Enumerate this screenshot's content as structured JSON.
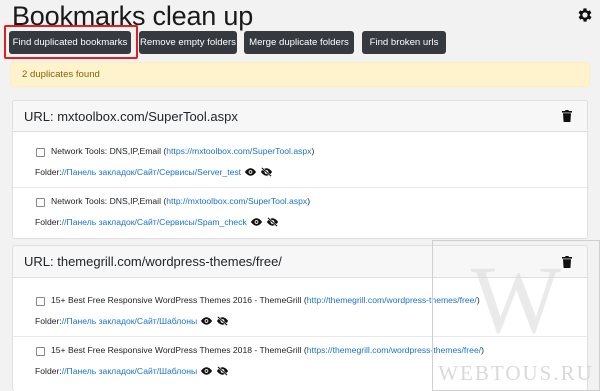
{
  "header": {
    "title": "Bookmarks clean up",
    "settings_icon": "gear-icon"
  },
  "toolbar": {
    "find_duplicates": "Find duplicated bookmarks",
    "remove_empty": "Remove empty folders",
    "merge_duplicates": "Merge duplicate folders",
    "find_broken": "Find broken urls"
  },
  "alert": {
    "text": "2 duplicates found"
  },
  "groups": [
    {
      "url_label": "URL: mxtoolbox.com/SuperTool.aspx",
      "items": [
        {
          "title": "Network Tools: DNS,IP,Email (",
          "url": "https://mxtoolbox.com/SuperTool.aspx",
          "close": ")",
          "folder_label": "Folder: ",
          "folder_path": "//Панель закладок/Сайт/Сервисы/Server_test"
        },
        {
          "title": "Network Tools: DNS,IP,Email (",
          "url": "http://mxtoolbox.com/SuperTool.aspx",
          "close": ")",
          "folder_label": "Folder: ",
          "folder_path": "//Панель закладок/Сайт/Сервисы/Spam_check"
        }
      ]
    },
    {
      "url_label": "URL: themegrill.com/wordpress-themes/free/",
      "items": [
        {
          "title": "15+ Best Free Responsive WordPress Themes 2016 - ThemeGrill (",
          "url": "http://themegrill.com/wordpress-themes/free/",
          "close": ")",
          "folder_label": "Folder: ",
          "folder_path": "//Панель закладок/Сайт/Шаблоны"
        },
        {
          "title": "15+ Best Free Responsive WordPress Themes 2018 - ThemeGrill (",
          "url": "https://themegrill.com/wordpress-themes/free/",
          "close": ")",
          "folder_label": "Folder: ",
          "folder_path": "//Панель закладок/Сайт/Шаблоны"
        }
      ]
    }
  ],
  "watermark": {
    "letter": "W",
    "text": "WEBTOUS.RU"
  },
  "colors": {
    "button_bg": "#343a40",
    "link": "#1a73c9",
    "alert_bg": "#fff3cd",
    "highlight": "#e02020"
  }
}
